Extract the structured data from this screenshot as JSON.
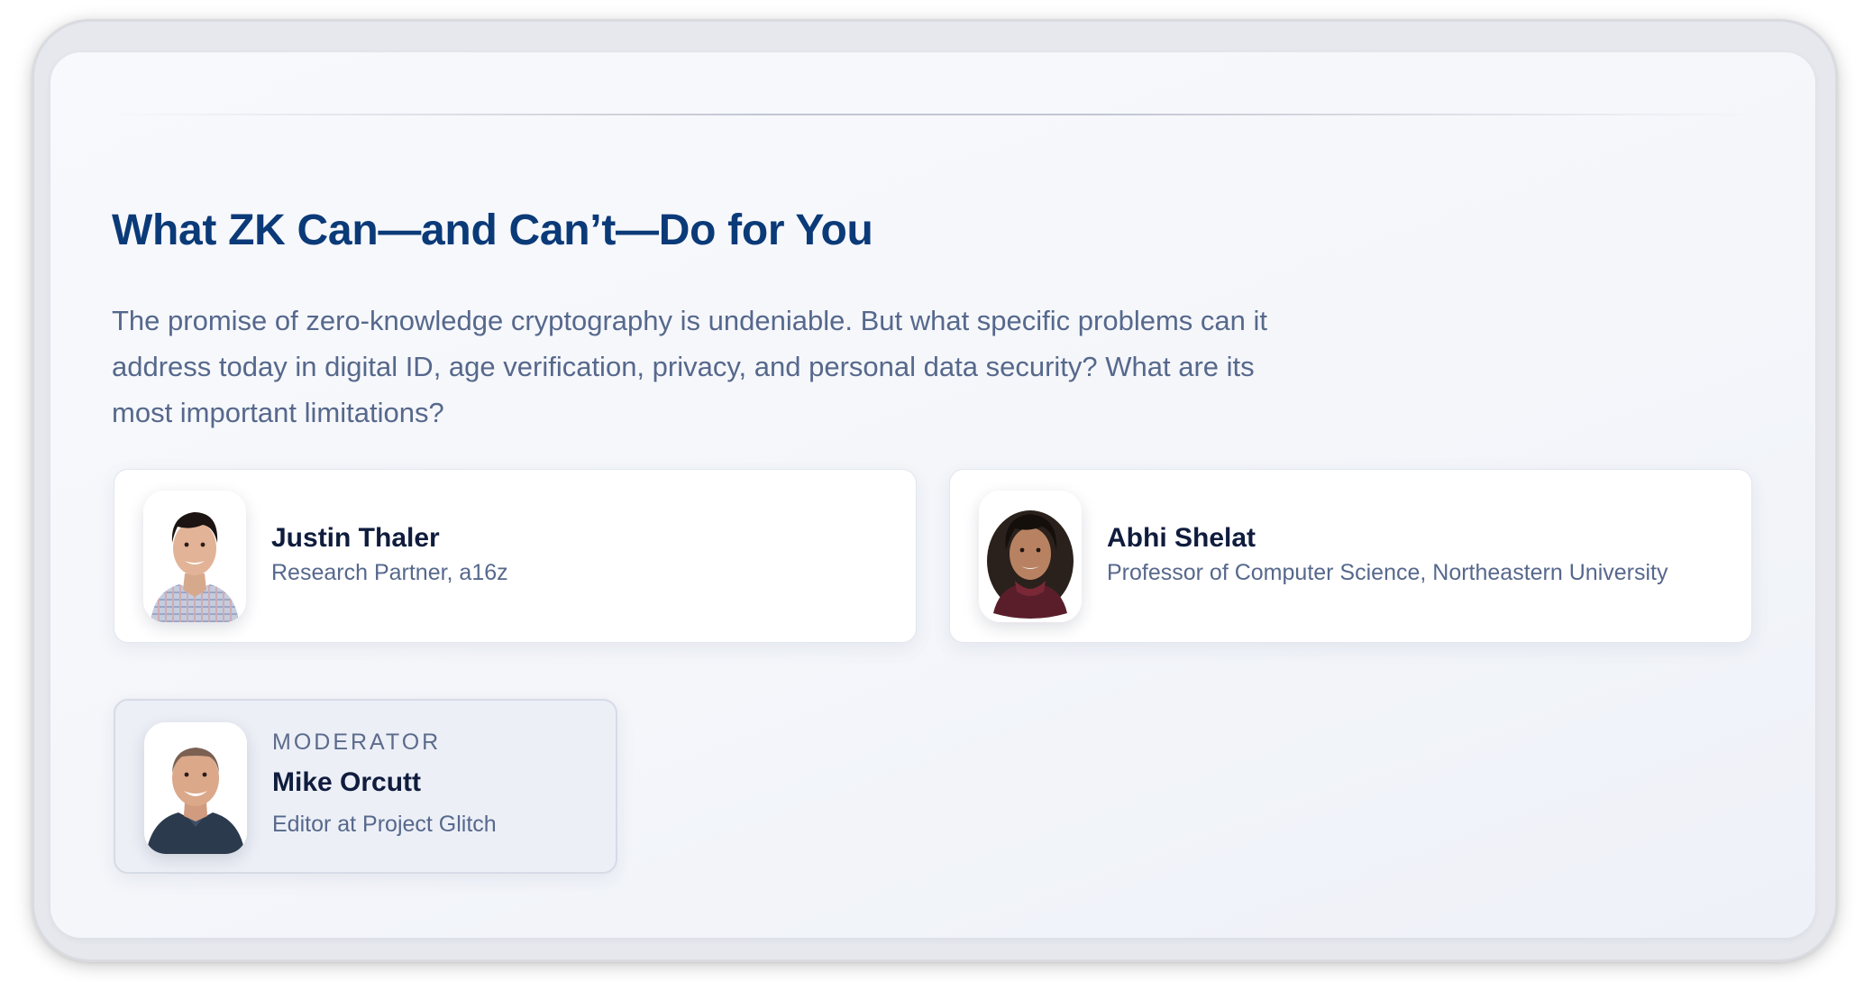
{
  "section": {
    "title": "What ZK Can—and Can’t—Do for You",
    "description": "The promise of zero-knowledge cryptography is undeniable. But what specific problems can it address today in digital ID, age verification, privacy, and personal data security? What are its most important limitations?"
  },
  "speakers": [
    {
      "name": "Justin Thaler",
      "affiliation": "Research Partner, a16z",
      "avatar": "portrait-photo"
    },
    {
      "name": "Abhi Shelat",
      "affiliation": "Professor of Computer Science, Northeastern University",
      "avatar": "portrait-photo"
    }
  ],
  "moderator": {
    "role_label": "MODERATOR",
    "name": "Mike Orcutt",
    "affiliation": "Editor at Project Glitch",
    "avatar": "portrait-photo"
  },
  "colors": {
    "title": "#0b3a78",
    "body_text": "#56688c",
    "name_text": "#0f1c3d",
    "card_bg": "#ffffff",
    "moderator_card_bg": "#eceff6"
  }
}
